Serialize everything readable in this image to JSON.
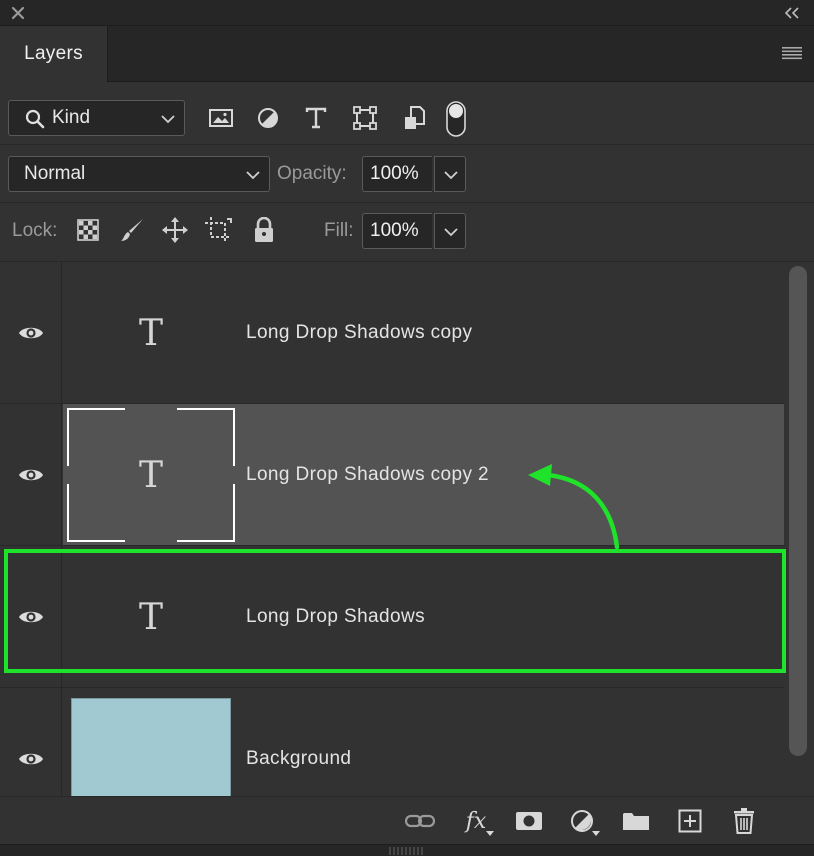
{
  "panel": {
    "tab_label": "Layers",
    "close_icon": "close-icon",
    "collapse_icon": "double-chevron-left-icon",
    "menu_icon": "hamburger-menu-icon"
  },
  "filter": {
    "kind_label": "Kind",
    "icons": [
      "image-filter-icon",
      "adjustment-filter-icon",
      "type-filter-icon",
      "shape-filter-icon",
      "smart-object-filter-icon",
      "filter-toggle-icon"
    ]
  },
  "blend": {
    "mode": "Normal",
    "opacity_label": "Opacity:",
    "opacity_value": "100%"
  },
  "lock": {
    "label": "Lock:",
    "icons": [
      "lock-transparent-pixels-icon",
      "lock-image-pixels-icon",
      "lock-position-icon",
      "lock-artboard-icon",
      "lock-all-icon"
    ],
    "fill_label": "Fill:",
    "fill_value": "100%"
  },
  "layers": [
    {
      "name": "Long Drop Shadows copy",
      "type": "text",
      "selected": false
    },
    {
      "name": "Long Drop Shadows copy 2",
      "type": "text",
      "selected": true
    },
    {
      "name": "Long Drop Shadows",
      "type": "text",
      "selected": false
    },
    {
      "name": "Background",
      "type": "image",
      "thumb_color": "#a0c9d1",
      "selected": false
    }
  ],
  "type_glyph": "T",
  "annotation": {
    "highlight_color": "#1fe22a",
    "arrow_color": "#1fe22a"
  },
  "bottom_icons": [
    "link-layers-icon",
    "fx-icon",
    "add-mask-icon",
    "new-adjustment-layer-icon",
    "new-group-icon",
    "new-layer-icon",
    "delete-layer-icon"
  ],
  "fx_label": "fx"
}
